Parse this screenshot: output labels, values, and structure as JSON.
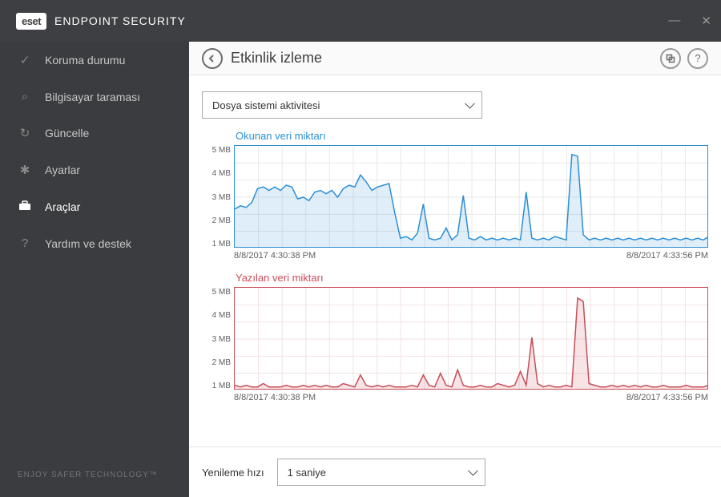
{
  "brand": {
    "logo_text": "eset",
    "product": "ENDPOINT SECURITY"
  },
  "sidebar": {
    "items": [
      {
        "label": "Koruma durumu",
        "icon": "✓"
      },
      {
        "label": "Bilgisayar taraması",
        "icon": "⌕"
      },
      {
        "label": "Güncelle",
        "icon": "↻"
      },
      {
        "label": "Ayarlar",
        "icon": "✱"
      },
      {
        "label": "Araçlar",
        "icon": "🧰"
      },
      {
        "label": "Yardım ve destek",
        "icon": "?"
      }
    ],
    "footer": "ENJOY SAFER TECHNOLOGY™"
  },
  "header": {
    "title": "Etkinlik izleme"
  },
  "activity_select": {
    "value": "Dosya sistemi aktivitesi"
  },
  "refresh": {
    "label": "Yenileme hızı",
    "value": "1 saniye"
  },
  "chart_data": [
    {
      "type": "area",
      "title": "Okunan veri miktarı",
      "ylabel": "MB",
      "ylim": [
        0,
        6
      ],
      "yticks": [
        "5 MB",
        "4 MB",
        "3 MB",
        "2 MB",
        "1 MB"
      ],
      "xrange": [
        "8/8/2017 4:30:38 PM",
        "8/8/2017 4:33:56 PM"
      ],
      "series": [
        {
          "name": "read",
          "color": "#2b8fd6",
          "values": [
            2.3,
            2.5,
            2.4,
            2.7,
            3.5,
            3.6,
            3.4,
            3.6,
            3.4,
            3.7,
            3.6,
            2.9,
            3.0,
            2.8,
            3.3,
            3.4,
            3.2,
            3.4,
            3.0,
            3.5,
            3.7,
            3.6,
            4.3,
            3.9,
            3.4,
            3.6,
            3.7,
            3.8,
            2.1,
            0.6,
            0.7,
            0.5,
            0.9,
            2.6,
            0.6,
            0.5,
            0.6,
            1.2,
            0.5,
            0.8,
            3.1,
            0.6,
            0.5,
            0.7,
            0.5,
            0.6,
            0.5,
            0.6,
            0.5,
            0.6,
            0.5,
            3.3,
            0.6,
            0.5,
            0.6,
            0.5,
            0.7,
            0.6,
            0.5,
            5.5,
            5.4,
            0.8,
            0.5,
            0.6,
            0.5,
            0.6,
            0.5,
            0.6,
            0.5,
            0.6,
            0.5,
            0.6,
            0.5,
            0.6,
            0.5,
            0.6,
            0.5,
            0.6,
            0.5,
            0.6,
            0.5,
            0.6,
            0.5,
            0.7
          ]
        }
      ]
    },
    {
      "type": "area",
      "title": "Yazılan veri miktarı",
      "ylabel": "MB",
      "ylim": [
        0,
        6
      ],
      "yticks": [
        "5 MB",
        "4 MB",
        "3 MB",
        "2 MB",
        "1 MB"
      ],
      "xrange": [
        "8/8/2017 4:30:38 PM",
        "8/8/2017 4:33:56 PM"
      ],
      "series": [
        {
          "name": "write",
          "color": "#c84d58",
          "values": [
            0.3,
            0.2,
            0.3,
            0.2,
            0.2,
            0.4,
            0.2,
            0.2,
            0.2,
            0.3,
            0.2,
            0.2,
            0.3,
            0.2,
            0.3,
            0.2,
            0.3,
            0.2,
            0.2,
            0.4,
            0.3,
            0.2,
            0.9,
            0.3,
            0.2,
            0.3,
            0.2,
            0.3,
            0.2,
            0.2,
            0.2,
            0.3,
            0.2,
            0.9,
            0.3,
            0.2,
            1.0,
            0.3,
            0.2,
            1.2,
            0.3,
            0.2,
            0.2,
            0.3,
            0.2,
            0.2,
            0.4,
            0.3,
            0.2,
            0.3,
            1.1,
            0.3,
            3.1,
            0.4,
            0.2,
            0.3,
            0.2,
            0.2,
            0.3,
            0.2,
            5.4,
            5.2,
            0.4,
            0.3,
            0.2,
            0.2,
            0.3,
            0.2,
            0.3,
            0.2,
            0.3,
            0.2,
            0.3,
            0.2,
            0.2,
            0.3,
            0.2,
            0.2,
            0.2,
            0.3,
            0.2,
            0.2,
            0.2,
            0.3
          ]
        }
      ]
    }
  ]
}
